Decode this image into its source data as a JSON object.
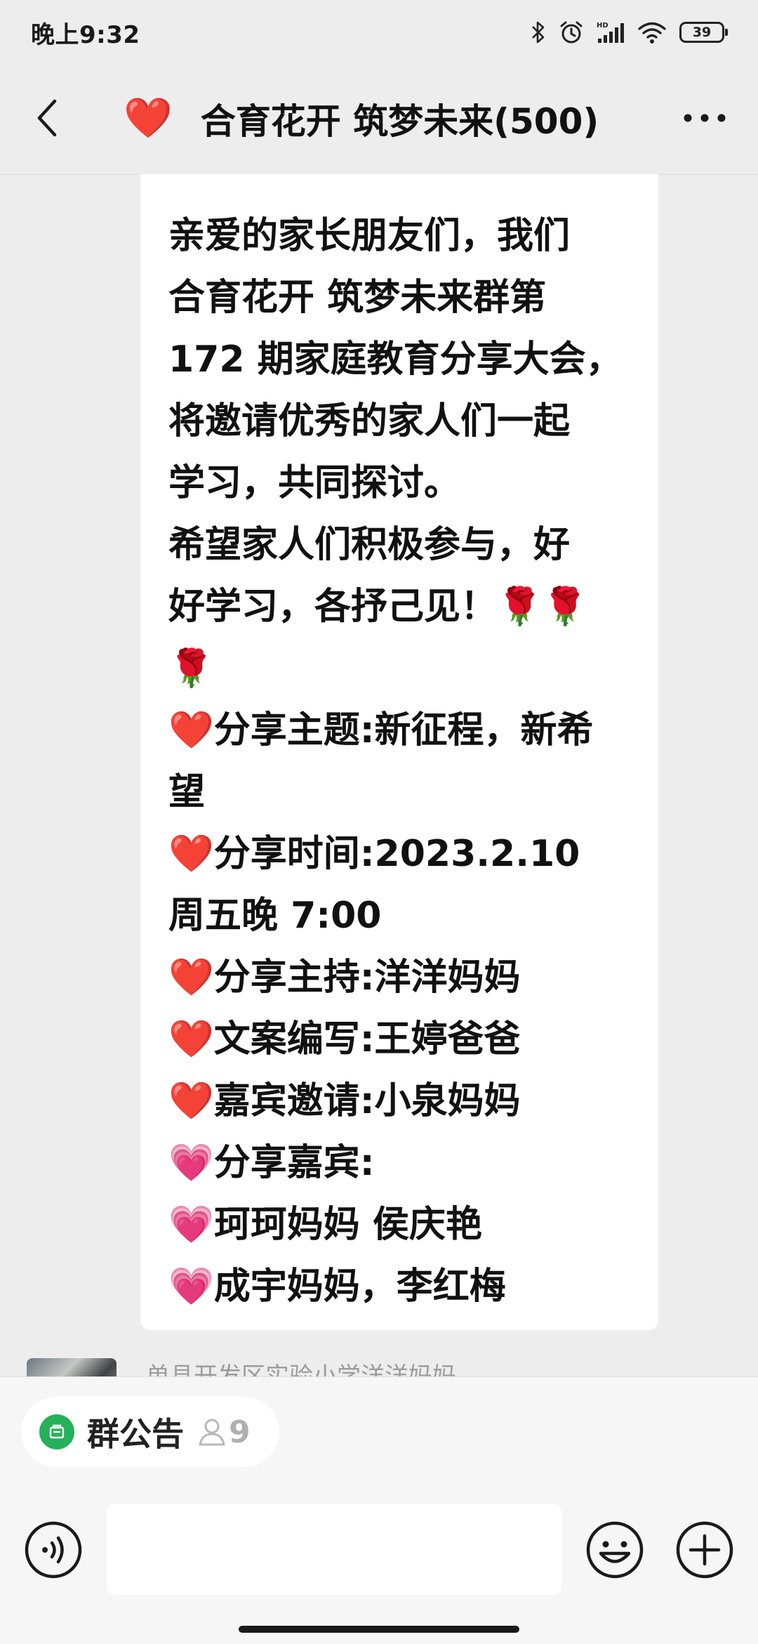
{
  "status_bar": {
    "time": "晚上9:32",
    "battery": "39",
    "icons": [
      "bluetooth-icon",
      "alarm-icon",
      "hd-signal-icon",
      "wifi-icon",
      "battery-icon"
    ]
  },
  "header": {
    "title_emoji": "❤️",
    "title": "合育花开 筑梦未来(500)",
    "back_icon": "chevron-left-icon",
    "more_icon": "more-dots-icon"
  },
  "message": {
    "lines": [
      "亲爱的家长朋友们，我们",
      "合育花开  筑梦未来群第",
      "172 期家庭教育分享大会，",
      "将邀请优秀的家人们一起",
      "学习，共同探讨。",
      "希望家人们积极参与，好",
      "好学习，各抒己见！🌹🌹",
      "🌹",
      "❤️分享主题:新征程，新希",
      "望",
      "❤️分享时间:2023.2.10",
      "周五晚 7:00",
      "❤️分享主持:洋洋妈妈",
      "❤️文案编写:王婷爸爸",
      "❤️嘉宾邀请:小泉妈妈",
      "💗分享嘉宾:",
      "💗珂珂妈妈 侯庆艳",
      "💗成宇妈妈，李红梅"
    ]
  },
  "next_message": {
    "sender_name": "单县开发区实验小学洋洋妈妈"
  },
  "notice": {
    "label": "群公告",
    "count": "9"
  },
  "input": {
    "voice_icon": "voice-icon",
    "emoji_icon": "smiley-icon",
    "plus_icon": "plus-icon"
  },
  "colors": {
    "background": "#ededed",
    "bubble": "#ffffff",
    "notice_green": "#25b05a"
  }
}
